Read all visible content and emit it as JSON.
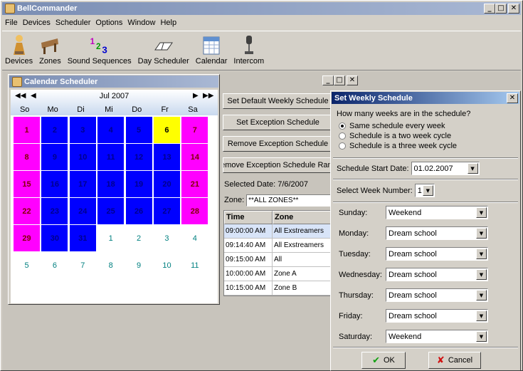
{
  "app": {
    "title": "BellCommander"
  },
  "menu": [
    "File",
    "Devices",
    "Scheduler",
    "Options",
    "Window",
    "Help"
  ],
  "toolbar": [
    {
      "label": "Devices",
      "icon": "devices-icon"
    },
    {
      "label": "Zones",
      "icon": "zones-icon"
    },
    {
      "label": "Sound Sequences",
      "icon": "sound-sequences-icon"
    },
    {
      "label": "Day Scheduler",
      "icon": "day-scheduler-icon"
    },
    {
      "label": "Calendar",
      "icon": "calendar-icon"
    },
    {
      "label": "Intercom",
      "icon": "intercom-icon"
    }
  ],
  "calendar": {
    "title": "Calendar Scheduler",
    "month": "Jul 2007",
    "prev_year": "◀◀",
    "prev_month": "◀",
    "next_month": "▶",
    "next_year": "▶▶",
    "dows": [
      "So",
      "Mo",
      "Di",
      "Mi",
      "Do",
      "Fr",
      "Sa"
    ],
    "days": [
      {
        "n": "1",
        "c": "pink"
      },
      {
        "n": "2",
        "c": "blue"
      },
      {
        "n": "3",
        "c": "blue"
      },
      {
        "n": "4",
        "c": "blue"
      },
      {
        "n": "5",
        "c": "blue"
      },
      {
        "n": "6",
        "c": "yellow"
      },
      {
        "n": "7",
        "c": "pink"
      },
      {
        "n": "8",
        "c": "pink"
      },
      {
        "n": "9",
        "c": "blue"
      },
      {
        "n": "10",
        "c": "blue"
      },
      {
        "n": "11",
        "c": "blue"
      },
      {
        "n": "12",
        "c": "blue"
      },
      {
        "n": "13",
        "c": "blue"
      },
      {
        "n": "14",
        "c": "pink"
      },
      {
        "n": "15",
        "c": "pink"
      },
      {
        "n": "16",
        "c": "blue"
      },
      {
        "n": "17",
        "c": "blue"
      },
      {
        "n": "18",
        "c": "blue"
      },
      {
        "n": "19",
        "c": "blue"
      },
      {
        "n": "20",
        "c": "blue"
      },
      {
        "n": "21",
        "c": "pink"
      },
      {
        "n": "22",
        "c": "pink"
      },
      {
        "n": "23",
        "c": "blue"
      },
      {
        "n": "24",
        "c": "blue"
      },
      {
        "n": "25",
        "c": "blue"
      },
      {
        "n": "26",
        "c": "blue"
      },
      {
        "n": "27",
        "c": "blue"
      },
      {
        "n": "28",
        "c": "pink"
      },
      {
        "n": "29",
        "c": "pink"
      },
      {
        "n": "30",
        "c": "blue"
      },
      {
        "n": "31",
        "c": "blue"
      },
      {
        "n": "1",
        "c": "plain"
      },
      {
        "n": "2",
        "c": "plain"
      },
      {
        "n": "3",
        "c": "plain"
      },
      {
        "n": "4",
        "c": "plain"
      },
      {
        "n": "5",
        "c": "plain"
      },
      {
        "n": "6",
        "c": "plain"
      },
      {
        "n": "7",
        "c": "plain"
      },
      {
        "n": "8",
        "c": "plain"
      },
      {
        "n": "9",
        "c": "plain"
      },
      {
        "n": "10",
        "c": "plain"
      },
      {
        "n": "11",
        "c": "plain"
      }
    ],
    "buttons": [
      "Set Default Weekly Schedule",
      "Set Exception Schedule",
      "Remove Exception Schedule",
      "Remove Exception Schedule Range"
    ],
    "selected_date": "Selected Date: 7/6/2007",
    "zone_label": "Zone:",
    "zone_value": "**ALL ZONES**",
    "table": {
      "headers": [
        "Time",
        "Zone"
      ],
      "rows": [
        [
          "09:00:00 AM",
          "All Exstreamers"
        ],
        [
          "09:14:40 AM",
          "All Exstreamers"
        ],
        [
          "09:15:00 AM",
          "All"
        ],
        [
          "10:00:00 AM",
          "Zone A"
        ],
        [
          "10:15:00 AM",
          "Zone B"
        ]
      ]
    }
  },
  "dialog": {
    "title": "Set Weekly Schedule",
    "question": "How many weeks are in the schedule?",
    "options": [
      "Same schedule every week",
      "Schedule is a two week cycle",
      "Schedule is a three week cycle"
    ],
    "start_label": "Schedule Start Date:",
    "start_value": "01.02.2007",
    "week_label": "Select Week Number:",
    "week_value": "1",
    "days": [
      {
        "day": "Sunday:",
        "value": "Weekend"
      },
      {
        "day": "Monday:",
        "value": "Dream school"
      },
      {
        "day": "Tuesday:",
        "value": "Dream school"
      },
      {
        "day": "Wednesday:",
        "value": "Dream school"
      },
      {
        "day": "Thursday:",
        "value": "Dream school"
      },
      {
        "day": "Friday:",
        "value": "Dream school"
      },
      {
        "day": "Saturday:",
        "value": "Weekend"
      }
    ],
    "ok": "OK",
    "cancel": "Cancel"
  }
}
